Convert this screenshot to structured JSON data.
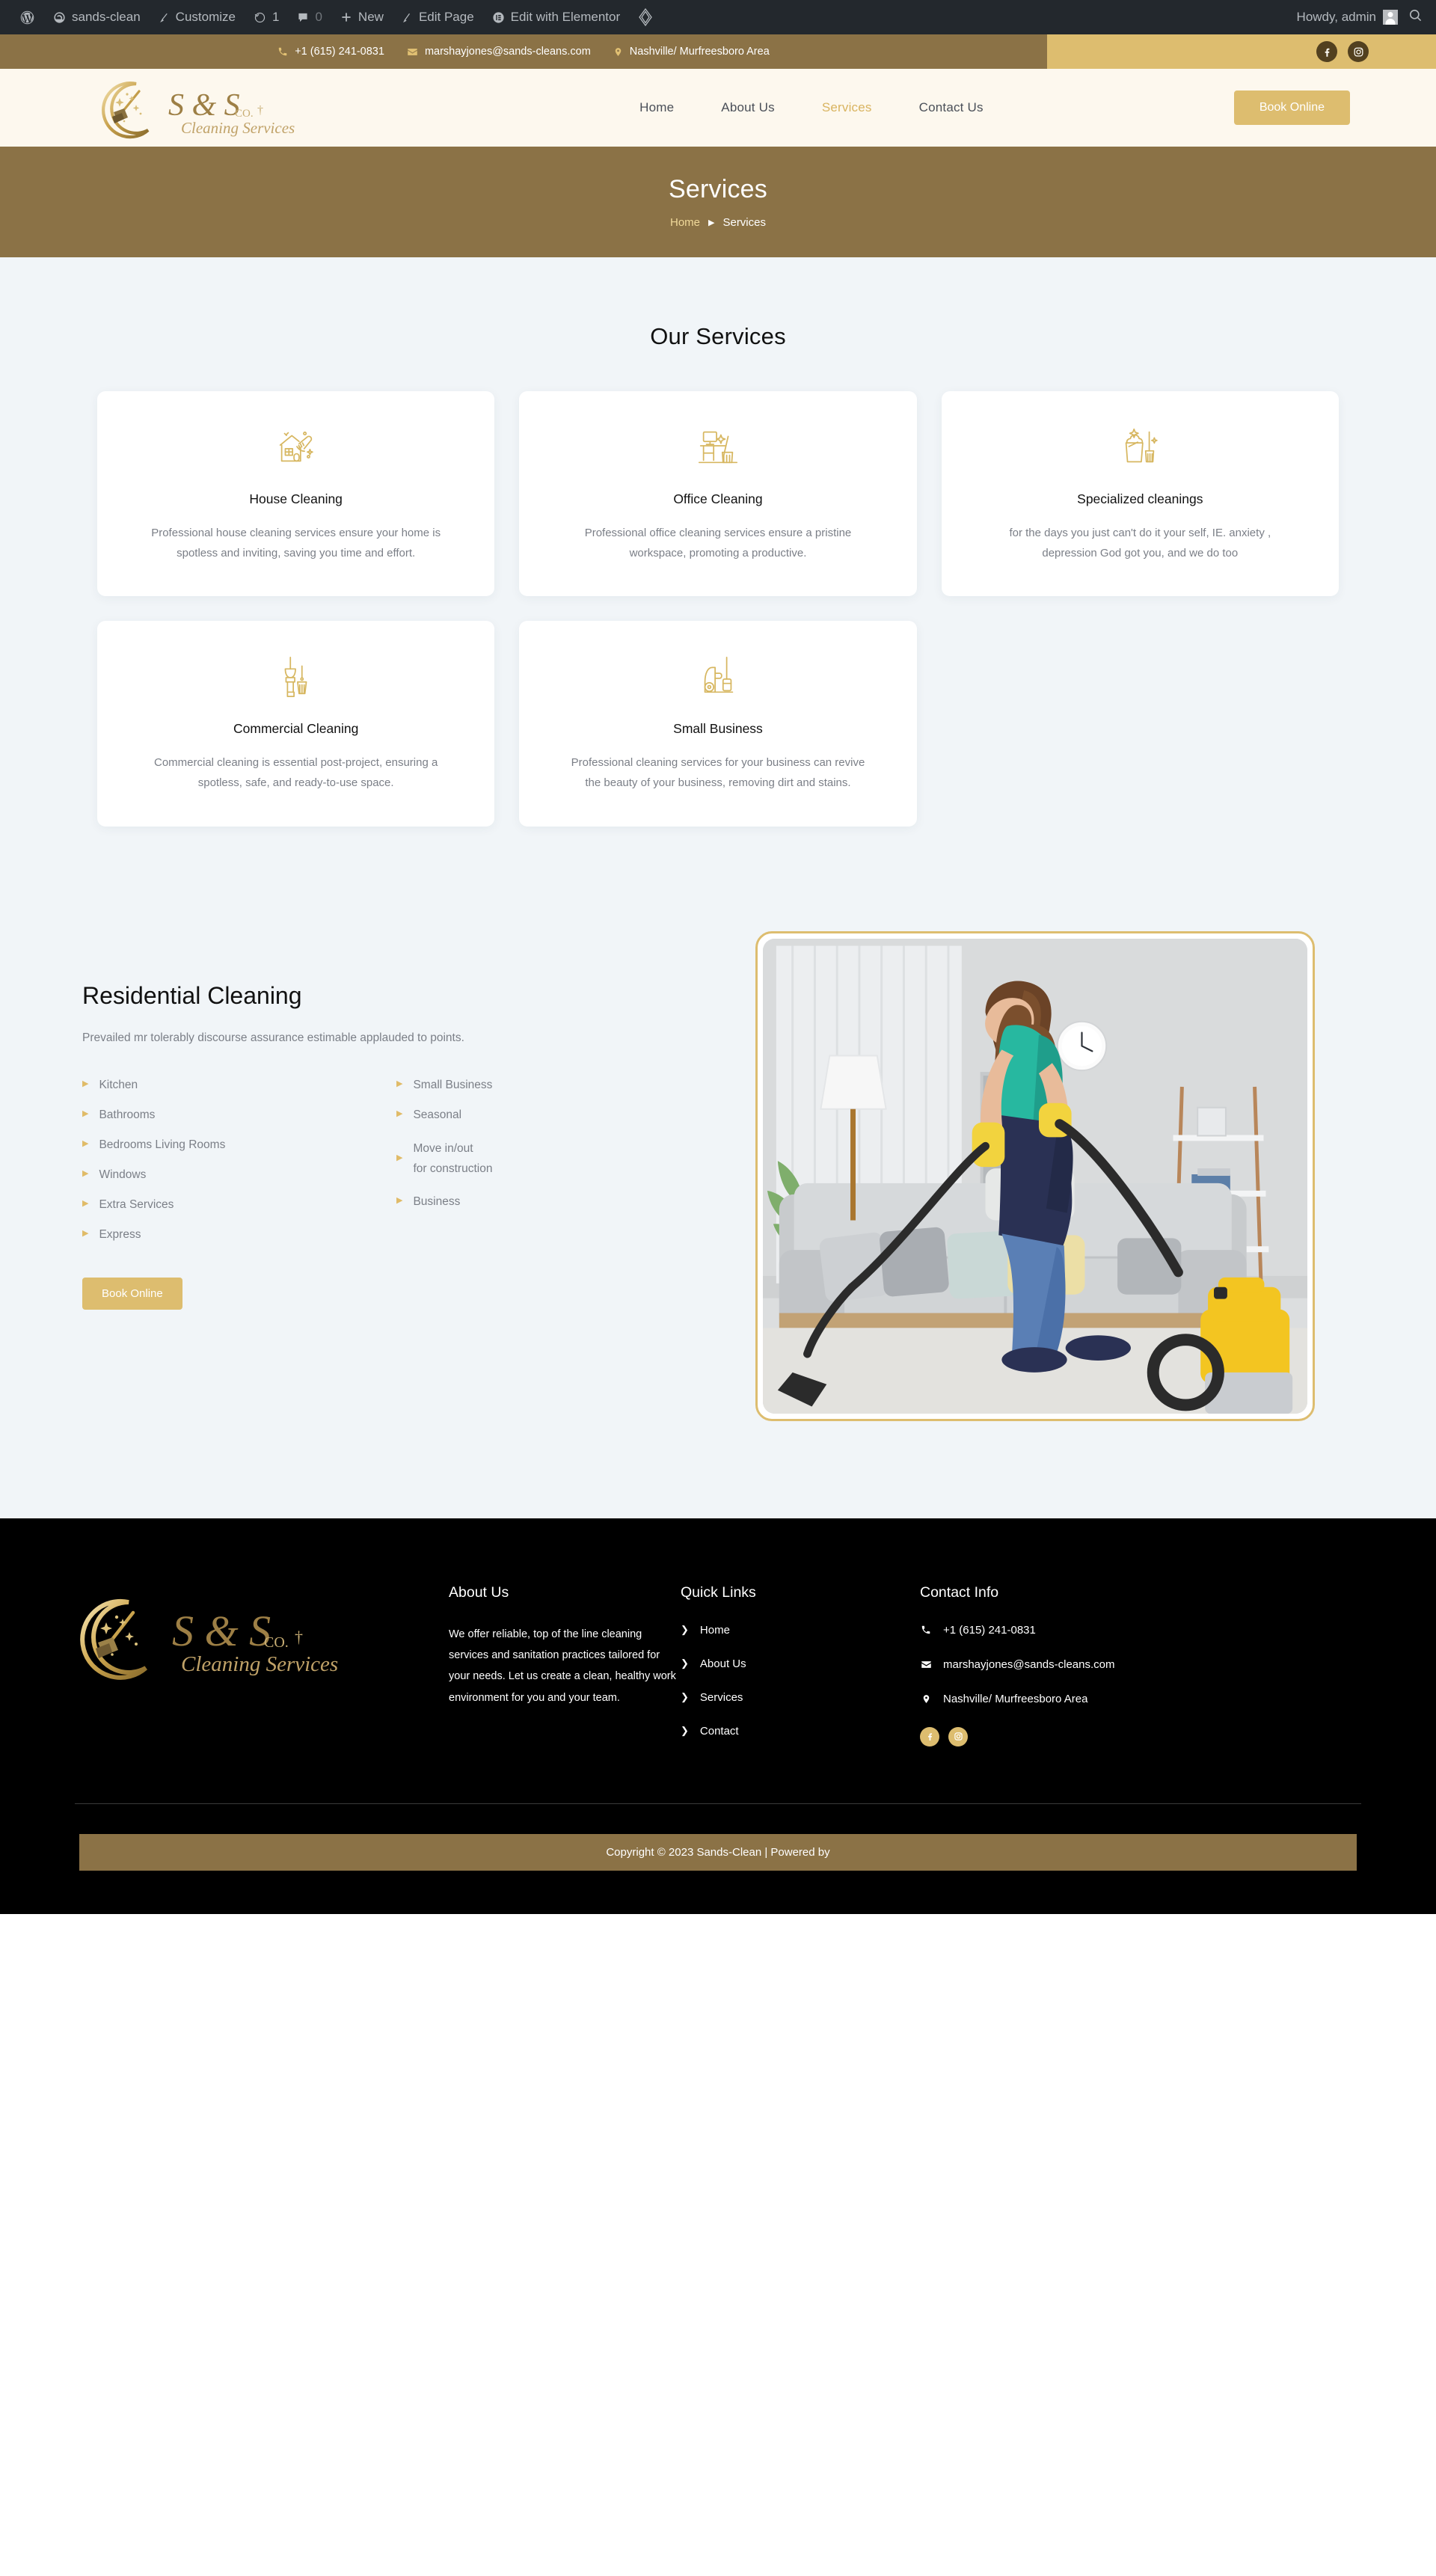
{
  "adminbar": {
    "wp_logo": "wordpress-icon",
    "site_name": "sands-clean",
    "customize": "Customize",
    "revisions_count": "1",
    "comments_count": "0",
    "new": "New",
    "edit_page": "Edit Page",
    "edit_with_elementor": "Edit with Elementor",
    "howdy": "Howdy, admin"
  },
  "topbar": {
    "phone": "+1 (615) 241-0831",
    "email": "marshayjones@sands-cleans.com",
    "location": "Nashville/ Murfreesboro Area",
    "socials": [
      "facebook-icon",
      "instagram-icon"
    ]
  },
  "header": {
    "logo_primary": "S & S",
    "logo_suffix": "CO.",
    "logo_script": "Cleaning Services",
    "nav": [
      {
        "label": "Home",
        "active": false
      },
      {
        "label": "About Us",
        "active": false
      },
      {
        "label": "Services",
        "active": true
      },
      {
        "label": "Contact Us",
        "active": false
      }
    ],
    "cta_label": "Book Online"
  },
  "hero": {
    "title": "Services",
    "breadcrumb_home": "Home",
    "breadcrumb_sep": "▶",
    "breadcrumb_current": "Services"
  },
  "services": {
    "heading": "Our Services",
    "cards": [
      {
        "icon": "house-broom-icon",
        "title": "House Cleaning",
        "desc": "Professional house cleaning services ensure your home is spotless and inviting, saving you time and effort."
      },
      {
        "icon": "desk-broom-icon",
        "title": "Office Cleaning",
        "desc": "Professional office cleaning services ensure a pristine workspace, promoting a productive."
      },
      {
        "icon": "bucket-broom-icon",
        "title": "Specialized cleanings",
        "desc": "for the days you just can't do it your self, IE. anxiety , depression God got you, and we do too"
      },
      {
        "icon": "mop-broom-icon",
        "title": "Commercial Cleaning",
        "desc": "Commercial cleaning is essential post-project, ensuring a spotless, safe, and ready-to-use space."
      },
      {
        "icon": "vacuum-icon",
        "title": "Small Business",
        "desc": "Professional cleaning services for your business can revive the beauty of your business, removing dirt and stains."
      }
    ]
  },
  "residential": {
    "title": "Residential Cleaning",
    "subtitle": "Prevailed mr tolerably discourse assurance estimable applauded to points.",
    "list_left": [
      "Kitchen",
      "Bathrooms",
      "Bedrooms Living Rooms",
      "Windows",
      "Extra Services",
      "Express"
    ],
    "list_right": [
      "Small Business",
      "Seasonal",
      "Move in/out\nfor construction",
      "Business"
    ],
    "cta_label": "Book Online",
    "photo_alt": "woman-vacuuming-living-room-photo"
  },
  "footer": {
    "logo_primary": "S & S",
    "logo_suffix": "CO.",
    "logo_script": "Cleaning Services",
    "about_heading": "About Us",
    "about_text": "We offer reliable, top of the line cleaning services and sanitation practices tailored for your needs. Let us create a clean, healthy work environment for you and your team.",
    "links_heading": "Quick Links",
    "links": [
      "Home",
      "About Us",
      "Services",
      "Contact"
    ],
    "contact_heading": "Contact Info",
    "contact_phone": "+1 (615) 241-0831",
    "contact_email": "marshayjones@sands-cleans.com",
    "contact_address": "Nashville/ Murfreesboro Area",
    "socials": [
      "facebook-icon",
      "instagram-icon"
    ],
    "copyright": "Copyright © 2023 Sands-Clean | Powered by"
  },
  "colors": {
    "brand_gold": "#ddbd6f",
    "brand_brown": "#8b7246",
    "bg_light": "#f1f5f8",
    "header_cream": "#fdf8ee",
    "footer_black": "#000000"
  }
}
